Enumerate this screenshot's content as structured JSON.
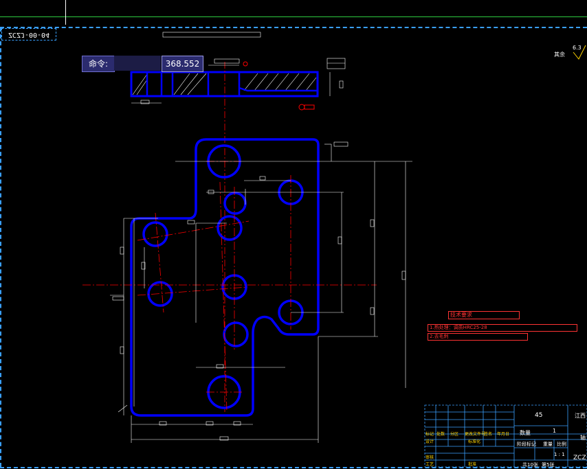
{
  "window": {
    "doc_number": "ZCZJ-00-04"
  },
  "command": {
    "label": "命令:",
    "value": "368.552"
  },
  "roughness": {
    "label": "其余",
    "value": "6.3"
  },
  "tech_requirements": {
    "title": "技术要求",
    "items": [
      "1.热处理：调质HRC25-28",
      "2.去毛刺"
    ]
  },
  "title_block": {
    "material": "45",
    "company": "江西",
    "quantity_label": "数量",
    "quantity": "1",
    "part_short": "轴",
    "stage_label": "阶段标记",
    "weight_label": "重量",
    "scale_label": "比例",
    "scale": "1 : 1",
    "code": "ZCZ",
    "sheets": "共10张",
    "sheet": "第5张",
    "row_labels": [
      "标记",
      "处数",
      "分区",
      "更改文件号",
      "签名",
      "年月日"
    ],
    "design": "设计",
    "standard": "标准化",
    "review": "审核",
    "process": "工艺",
    "approve": "批准"
  },
  "colors": {
    "outline": "#0000ff",
    "dim": "#ffffff",
    "center": "#ff0000",
    "frame": "#3aa0ff"
  }
}
